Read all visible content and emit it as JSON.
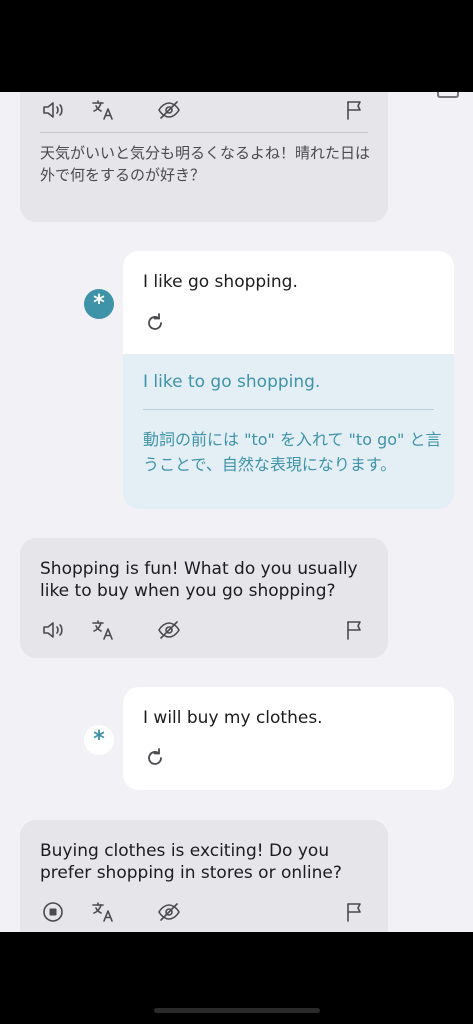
{
  "messages": [
    {
      "role": "ai",
      "text": "天気がいいと気分も明るくなるよね！晴れた日は外で何をするのが好き？"
    },
    {
      "role": "user",
      "text": "I like go shopping.",
      "correction": {
        "corrected": "I like to go shopping.",
        "explanation": "動詞の前には \"to\" を入れて \"to go\" と言うことで、自然な表現になります。"
      }
    },
    {
      "role": "ai",
      "text": "Shopping is fun! What do you usually like to buy when you go shopping?"
    },
    {
      "role": "user",
      "text": "I will buy my clothes."
    },
    {
      "role": "ai",
      "text": "Buying clothes is exciting! Do you prefer shopping in stores or online?"
    }
  ],
  "avatar_glyph": "*",
  "colors": {
    "accent": "#3f93a8",
    "background": "#f2f1f6",
    "ai_bubble": "#e6e5ea",
    "user_bubble": "#ffffff",
    "correction_bg": "#e3eff5"
  },
  "icons": [
    "speaker-icon",
    "translate-icon",
    "hide-icon",
    "flag-icon",
    "retry-icon",
    "stop-icon"
  ]
}
